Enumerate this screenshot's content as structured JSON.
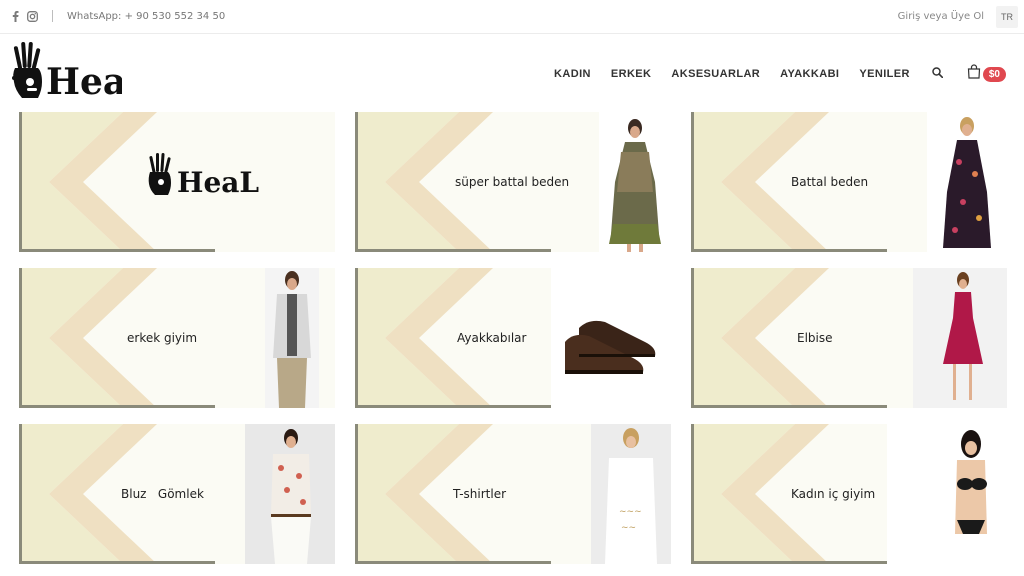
{
  "topbar": {
    "social_icons": [
      "facebook-icon",
      "instagram-icon"
    ],
    "whatsapp": "WhatsApp: + 90 530 552 34 50",
    "login": "Giriş veya Üye Ol",
    "language": "TR"
  },
  "brand": {
    "logo_text": "HeaL"
  },
  "nav": {
    "items": [
      "KADIN",
      "ERKEK",
      "AKSESUARLAR",
      "AYAKKABI",
      "YENILER"
    ],
    "search_icon": "search-icon",
    "cart_icon": "shopping-bag-icon",
    "cart_total": "$0"
  },
  "colors": {
    "accent": "#e0484f",
    "banner_texture": "#efeccd",
    "banner_chevron": "#efe0c2"
  },
  "tiles": [
    {
      "label": "",
      "logo": "HeaL",
      "photo": "none"
    },
    {
      "label": "süper battal beden",
      "photo": "dress-photo"
    },
    {
      "label": "Battal beden",
      "photo": "floral-dress-photo"
    },
    {
      "label": "erkek giyim",
      "photo": "man-photo"
    },
    {
      "label": "Ayakkabılar",
      "photo": "shoes-photo"
    },
    {
      "label": "Elbise",
      "photo": "red-dress-photo"
    },
    {
      "label": "Bluz   Gömlek",
      "photo": "blouse-photo"
    },
    {
      "label": "T-shirtler",
      "photo": "tshirt-photo"
    },
    {
      "label": "Kadın iç giyim",
      "photo": "lingerie-photo"
    }
  ]
}
